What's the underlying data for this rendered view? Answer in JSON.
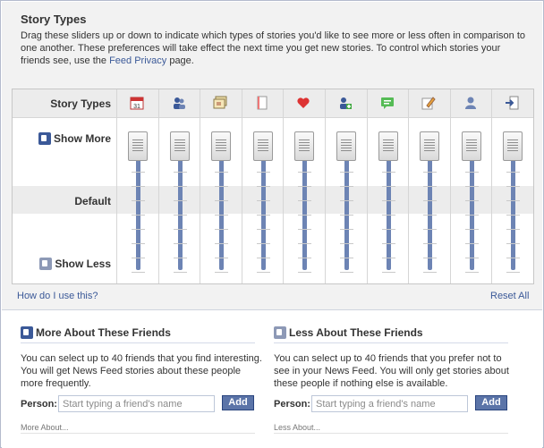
{
  "header": {
    "title": "Story Types",
    "description_before_link": "Drag these sliders up or down to indicate which types of stories you'd like to see more or less often in comparison to one another. These preferences will take effect the next time you get new stories. To control which stories your friends see, use the ",
    "feed_privacy_link": "Feed Privacy",
    "description_after_link": " page."
  },
  "grid": {
    "header_label": "Story Types",
    "show_more_label": "Show More",
    "default_label": "Default",
    "show_less_label": "Show Less",
    "columns": [
      {
        "icon": "calendar-icon",
        "icon_text": "31",
        "level": 1.0
      },
      {
        "icon": "friends-icon",
        "level": 1.0
      },
      {
        "icon": "photos-icon",
        "level": 1.0
      },
      {
        "icon": "notes-icon",
        "level": 1.0
      },
      {
        "icon": "heart-icon",
        "level": 1.0
      },
      {
        "icon": "add-friend-icon",
        "level": 1.0
      },
      {
        "icon": "wall-post-icon",
        "level": 1.0
      },
      {
        "icon": "pencil-edit-icon",
        "level": 1.0
      },
      {
        "icon": "profile-icon",
        "level": 1.0
      },
      {
        "icon": "application-icon",
        "level": 1.0
      }
    ]
  },
  "footer_links": {
    "help": "How do I use this?",
    "reset": "Reset All"
  },
  "more_about": {
    "title": "More About These Friends",
    "text": "You can select up to 40 friends that you find interesting. You will get News Feed stories about these people more frequently.",
    "person_label": "Person:",
    "placeholder": "Start typing a friend's name",
    "add_label": "Add",
    "more_label": "More About..."
  },
  "less_about": {
    "title": "Less About These Friends",
    "text": "You can select up to 40 friends that you prefer not to see in your News Feed. You will only get stories about these people if nothing else is available.",
    "person_label": "Person:",
    "placeholder": "Start typing a friend's name",
    "add_label": "Add",
    "more_label": "Less About..."
  },
  "colors": {
    "accent": "#3b5998",
    "slider": "#6d84b4"
  }
}
